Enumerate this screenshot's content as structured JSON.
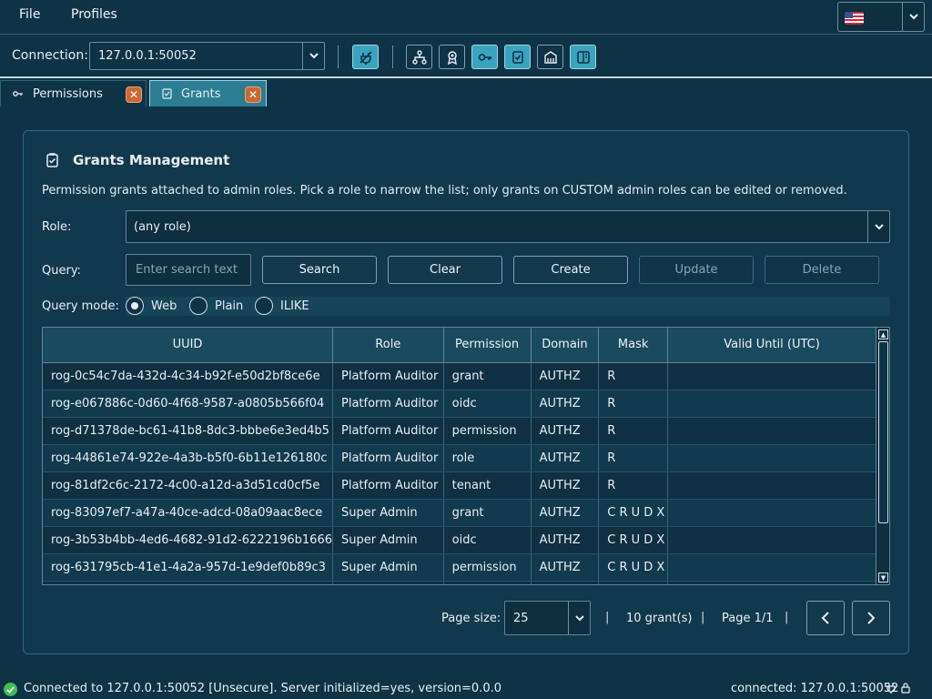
{
  "menubar": {
    "items": [
      {
        "label": "File"
      },
      {
        "label": "Profiles"
      }
    ],
    "language": {
      "flag": "us-flag-icon"
    }
  },
  "toolbar": {
    "connection_label": "Connection:",
    "connection_value": "127.0.0.1:50052",
    "buttons": [
      {
        "icon": "disconnect-plug-icon",
        "active": true
      },
      {
        "icon": "hierarchy-icon",
        "active": false
      },
      {
        "icon": "badge-icon",
        "active": false
      },
      {
        "icon": "key-icon",
        "active": true
      },
      {
        "icon": "grant-check-icon",
        "active": true
      },
      {
        "icon": "bank-icon",
        "active": false
      },
      {
        "icon": "book-icon",
        "active": true
      }
    ]
  },
  "tabs": [
    {
      "label": "Permissions",
      "active": false
    },
    {
      "label": "Grants",
      "active": true
    }
  ],
  "panel": {
    "title": "Grants Management",
    "description": "Permission grants attached to admin roles. Pick a role to narrow the list; only grants on CUSTOM admin roles can be edited or removed.",
    "role_label": "Role:",
    "role_value": "(any role)",
    "query_label": "Query:",
    "query_placeholder": "Enter search text",
    "buttons": {
      "search": "Search",
      "clear": "Clear",
      "create": "Create",
      "update": "Update",
      "delete": "Delete"
    },
    "query_mode_label": "Query mode:",
    "modes": [
      {
        "label": "Web",
        "checked": true
      },
      {
        "label": "Plain",
        "checked": false
      },
      {
        "label": "ILIKE",
        "checked": false
      }
    ]
  },
  "table": {
    "columns": [
      "UUID",
      "Role",
      "Permission",
      "Domain",
      "Mask",
      "Valid Until (UTC)"
    ],
    "rows": [
      [
        "rog-0c54c7da-432d-4c34-b92f-e50d2bf8ce6e",
        "Platform Auditor",
        "grant",
        "AUTHZ",
        "R",
        ""
      ],
      [
        "rog-e067886c-0d60-4f68-9587-a0805b566f04",
        "Platform Auditor",
        "oidc",
        "AUTHZ",
        "R",
        ""
      ],
      [
        "rog-d71378de-bc61-41b8-8dc3-bbbe6e3ed4b5",
        "Platform Auditor",
        "permission",
        "AUTHZ",
        "R",
        ""
      ],
      [
        "rog-44861e74-922e-4a3b-b5f0-6b11e126180c",
        "Platform Auditor",
        "role",
        "AUTHZ",
        "R",
        ""
      ],
      [
        "rog-81df2c6c-2172-4c00-a12d-a3d51cd0cf5e",
        "Platform Auditor",
        "tenant",
        "AUTHZ",
        "R",
        ""
      ],
      [
        "rog-83097ef7-a47a-40ce-adcd-08a09aac8ece",
        "Super Admin",
        "grant",
        "AUTHZ",
        "C R U D X",
        ""
      ],
      [
        "rog-3b53b4bb-4ed6-4682-91d2-6222196b1666",
        "Super Admin",
        "oidc",
        "AUTHZ",
        "C R U D X",
        ""
      ],
      [
        "rog-631795cb-41e1-4a2a-957d-1e9def0b89c3",
        "Super Admin",
        "permission",
        "AUTHZ",
        "C R U D X",
        ""
      ],
      [
        "",
        "",
        "",
        "",
        "",
        ""
      ]
    ]
  },
  "pagination": {
    "page_size_label": "Page size:",
    "page_size": "25",
    "sep": "|",
    "count": "10 grant(s)",
    "page": "Page 1/1"
  },
  "status": {
    "message": "Connected to 127.0.0.1:50052 [Unsecure]. Server initialized=yes, version=0.0.0",
    "right": "connected: 127.0.0.1:50052"
  },
  "colors": {
    "accent": "#3aa4bf",
    "background": "#0f3346",
    "close": "#c96a35",
    "ok": "#3fbf4f"
  }
}
